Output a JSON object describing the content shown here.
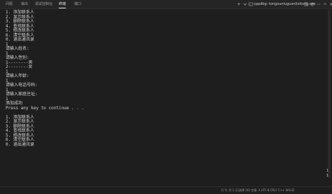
{
  "tabs": [
    {
      "label": "问题",
      "active": false
    },
    {
      "label": "输出",
      "active": false
    },
    {
      "label": "调试控制台",
      "active": false
    },
    {
      "label": "终端",
      "active": true
    },
    {
      "label": "端口",
      "active": false
    }
  ],
  "terminal_toolbar": {
    "add_icon": "+",
    "session_label": "cppdbg: tongxunluguanlixitong.exe",
    "icons": [
      "plus-icon",
      "split-terminal-icon",
      "trash-icon",
      "ellipsis-icon",
      "maximize-icon",
      "close-icon"
    ]
  },
  "terminal_lines": [
    "1. 添加联系人",
    "2. 显示联系人",
    "3. 删除联系人",
    "4. 查找联系人",
    "5. 修改联系人",
    "6. 清空联系人",
    "0. 退出通讯录",
    "1",
    "请输入姓名:",
    "1",
    "请输入性别:",
    "1--------男",
    "2--------女",
    "1",
    "请输入年龄:",
    "1",
    "请输入电话号码:",
    "1",
    "请输入家庭住址:",
    "1",
    "添加成功",
    "Press any key to continue . . .",
    "",
    "1. 添加联系人",
    "2. 显示联系人",
    "3. 删除联系人",
    "4. 查找联系人",
    "5. 修改联系人",
    "6. 清空联系人",
    "0. 退出通讯录"
  ],
  "side_numbers": [
    "1",
    "1"
  ],
  "status_bar": {
    "text": "行 9, 列 1 (已选择 26)   空格: 4   UTF-8   CRLF   C++   Win32"
  }
}
